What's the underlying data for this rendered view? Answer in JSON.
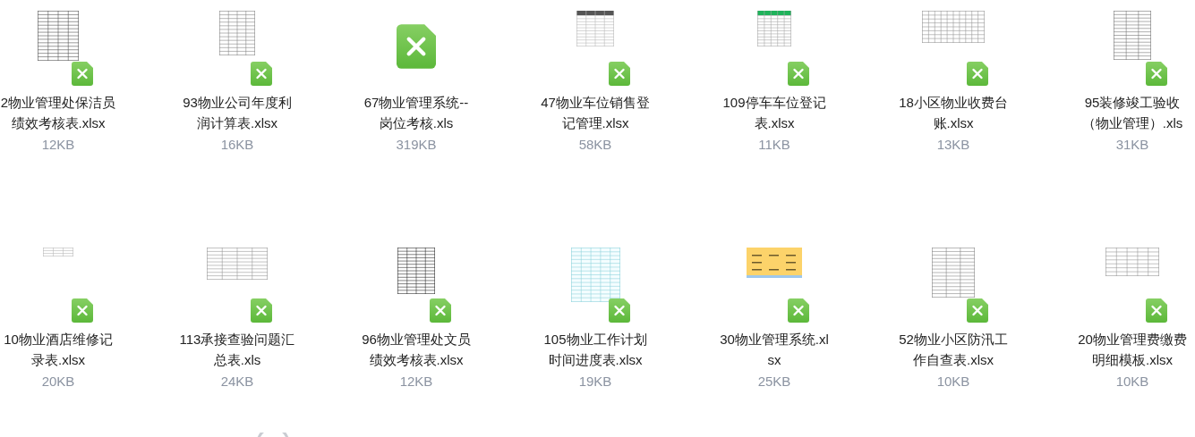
{
  "files": [
    {
      "kind": "picture",
      "name": "2物业管理处保洁员绩效考核表.xlsx",
      "size": "12KB"
    },
    {
      "kind": "picture",
      "name": "93物业公司年度利润计算表.xlsx",
      "size": "16KB"
    },
    {
      "kind": "icon",
      "name": "67物业管理系统--岗位考核.xls",
      "size": "319KB"
    },
    {
      "kind": "picture",
      "name": "47物业车位销售登记管理.xlsx",
      "size": "58KB"
    },
    {
      "kind": "picture",
      "name": "109停车车位登记表.xlsx",
      "size": "11KB"
    },
    {
      "kind": "picture",
      "name": "18小区物业收费台账.xlsx",
      "size": "13KB"
    },
    {
      "kind": "picture",
      "name": "95装修竣工验收（物业管理）.xls",
      "size": "31KB"
    },
    {
      "kind": "picture",
      "name": "10物业酒店维修记录表.xlsx",
      "size": "20KB"
    },
    {
      "kind": "picture",
      "name": "113承接查验问题汇总表.xls",
      "size": "24KB"
    },
    {
      "kind": "picture",
      "name": "96物业管理处文员绩效考核表.xlsx",
      "size": "12KB"
    },
    {
      "kind": "picture",
      "name": "105物业工作计划时间进度表.xlsx",
      "size": "19KB"
    },
    {
      "kind": "picture",
      "name": "30物业管理系统.xlsx",
      "size": "25KB"
    },
    {
      "kind": "picture",
      "name": "52物业小区防汛工作自查表.xlsx",
      "size": "10KB"
    },
    {
      "kind": "picture",
      "name": "20物业管理费缴费明细模板.xlsx",
      "size": "10KB"
    }
  ]
}
